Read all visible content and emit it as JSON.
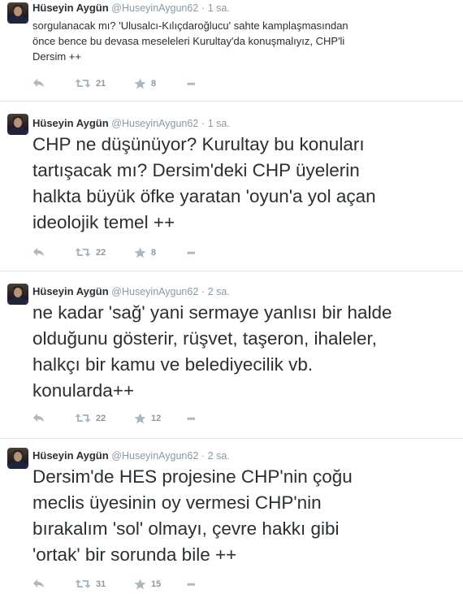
{
  "tweets": [
    {
      "name": "Hüseyin Aygün",
      "handle": "@HuseyinAygun62",
      "sep": "·",
      "time": "1 sa.",
      "lines": [
        "sorgulanacak mı? 'Ulusalcı-Kılıçdaroğlucu' sahte kamplaşmasından",
        "önce bence bu devasa meseleleri Kurultay'da konuşmalıyız, CHP'li",
        "Dersim ++"
      ],
      "retweets": "21",
      "favorites": "8",
      "more": "•••"
    },
    {
      "name": "Hüseyin Aygün",
      "handle": "@HuseyinAygun62",
      "sep": "·",
      "time": "1 sa.",
      "lines": [
        "CHP ne düşünüyor? Kurultay bu konuları",
        "tartışacak mı? Dersim'deki CHP üyelerin",
        "halkta büyük öfke yaratan 'oyun'a yol açan",
        "ideolojik temel ++"
      ],
      "retweets": "22",
      "favorites": "8",
      "more": "•••"
    },
    {
      "name": "Hüseyin Aygün",
      "handle": "@HuseyinAygun62",
      "sep": "·",
      "time": "2 sa.",
      "lines": [
        "ne kadar 'sağ' yani sermaye yanlısı bir halde",
        "olduğunu gösterir, rüşvet, taşeron, ihaleler,",
        "halkçı bir kamu ve belediyecilik vb.",
        "konularda++"
      ],
      "retweets": "22",
      "favorites": "12",
      "more": "•••"
    },
    {
      "name": "Hüseyin Aygün",
      "handle": "@HuseyinAygun62",
      "sep": "·",
      "time": "2 sa.",
      "lines": [
        "Dersim'de HES projesine CHP'nin çoğu",
        "meclis üyesinin oy vermesi CHP'nin",
        "bırakalım 'sol' olmayı, çevre hakkı gibi",
        "'ortak' bir sorunda bile ++"
      ],
      "retweets": "31",
      "favorites": "15",
      "more": "•••"
    }
  ],
  "colors": {
    "text": "#292f33",
    "muted": "#8899a6",
    "divider": "#e1e8ed"
  },
  "icons": {
    "reply": "reply-icon",
    "retweet": "retweet-icon",
    "favorite": "star-icon",
    "more": "more-icon"
  }
}
